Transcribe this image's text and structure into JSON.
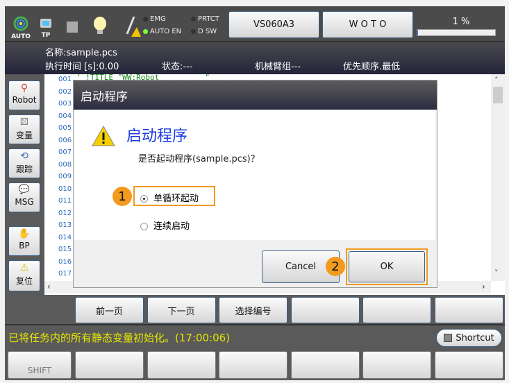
{
  "topbar": {
    "auto_label": "AUTO",
    "tp_label": "TP",
    "leds": [
      {
        "label": "EMG",
        "on": false
      },
      {
        "label": "PRTCT",
        "on": false
      },
      {
        "label": "AUTO EN",
        "on": true
      },
      {
        "label": "D SW",
        "on": false
      }
    ],
    "robot_button": "VS060A3",
    "woto_button": "W O T O",
    "speed": "1 %",
    "speed_fraction": 0.01
  },
  "info": {
    "name": "名称:sample.pcs",
    "exec_time": "执行时间 [s]:0.00",
    "state": "状态:---",
    "arm_group": "机械臂组---",
    "priority": "优先顺序.最低"
  },
  "sidebar": {
    "items": [
      {
        "label": "Robot",
        "icon": "robot-arm-icon"
      },
      {
        "label": "变量",
        "icon": "dice-icon"
      },
      {
        "label": "跟踪",
        "icon": "trace-icon"
      },
      {
        "label": "MSG",
        "icon": "message-icon"
      },
      {
        "label": "BP",
        "icon": "hand-icon"
      },
      {
        "label": "复位",
        "icon": "warning-icon"
      }
    ]
  },
  "code": {
    "line_numbers": [
      "001",
      "002",
      "003",
      "004",
      "005",
      "006",
      "007",
      "008",
      "009",
      "010",
      "011",
      "012",
      "013",
      "014",
      "015",
      "016",
      "017"
    ],
    "first_line": "' !TITLE \"WW:Robot          \""
  },
  "dialog": {
    "title": "启动程序",
    "heading": "启动程序",
    "message": "是否起动程序(sample.pcs)？",
    "options": [
      {
        "label": "单循环起动",
        "selected": true
      },
      {
        "label": "连续启动",
        "selected": false
      }
    ],
    "cancel": "Cancel",
    "ok": "OK",
    "step1": "1",
    "step2": "2"
  },
  "function_row": [
    "前一页",
    "下一页",
    "选择编号",
    "",
    "",
    ""
  ],
  "status": {
    "message": "已将任务内的所有静态变量初始化。(17:00:06)",
    "shortcut": "Shortcut",
    "color": "#e6e600"
  },
  "bottom_row": [
    "SHIFT",
    "",
    "",
    "",
    "",
    "",
    ""
  ],
  "accent": "#f39a1f"
}
